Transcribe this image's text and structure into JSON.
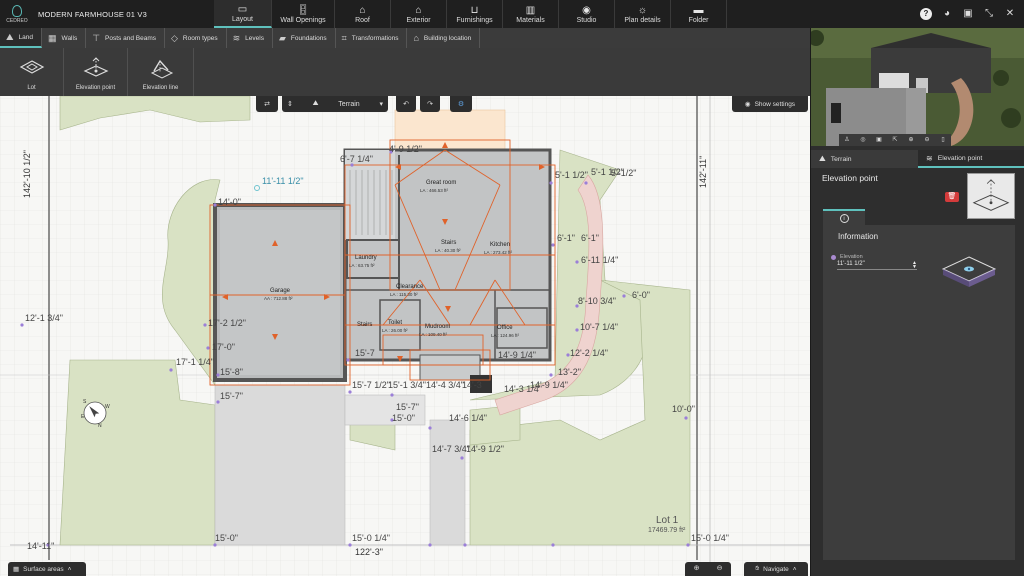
{
  "app": {
    "logo_text": "CEDREO",
    "project_title": "MODERN FARMHOUSE 01 V3"
  },
  "colors": {
    "accent": "#5fc1bd",
    "plan_lines": "#e0622a",
    "elevation_point": "#9b7fd8",
    "delete": "#d43b3b"
  },
  "main_tabs": [
    {
      "label": "Layout",
      "icon": "layout-icon"
    },
    {
      "label": "Wall Openings",
      "icon": "door-icon"
    },
    {
      "label": "Roof",
      "icon": "roof-icon"
    },
    {
      "label": "Exterior",
      "icon": "house-icon"
    },
    {
      "label": "Furnishings",
      "icon": "sofa-icon"
    },
    {
      "label": "Materials",
      "icon": "paint-roller-icon"
    },
    {
      "label": "Studio",
      "icon": "camera-icon"
    },
    {
      "label": "Plan details",
      "icon": "sun-icon"
    },
    {
      "label": "Folder",
      "icon": "folder-icon"
    }
  ],
  "sub_tabs": [
    {
      "label": "Land",
      "icon": "mountain-icon"
    },
    {
      "label": "Walls",
      "icon": "wall-icon"
    },
    {
      "label": "Posts and Beams",
      "icon": "beam-icon"
    },
    {
      "label": "Room types",
      "icon": "tag-icon"
    },
    {
      "label": "Levels",
      "icon": "levels-icon"
    },
    {
      "label": "Foundations",
      "icon": "foundation-icon"
    },
    {
      "label": "Transformations",
      "icon": "crop-icon"
    },
    {
      "label": "Building location",
      "icon": "location-icon"
    }
  ],
  "tools": [
    {
      "label": "Lot",
      "icon": "lot-icon"
    },
    {
      "label": "Elevation point",
      "icon": "elevation-point-icon"
    },
    {
      "label": "Elevation line",
      "icon": "elevation-line-icon"
    }
  ],
  "view_controls": {
    "terrain_label": "Terrain",
    "show_settings_label": "Show settings"
  },
  "bottom": {
    "surface_areas_label": "Surface areas",
    "navigate_label": "Navigate"
  },
  "plan": {
    "dimensions": {
      "left": "142'-10 1/2\"",
      "right": "142'-11\"",
      "bottom": "122'-3\""
    },
    "lot": {
      "name": "Lot 1",
      "area": "17469.79 ft²"
    },
    "rooms": [
      {
        "name": "Great room",
        "area": "LA : 466.53 ft²"
      },
      {
        "name": "Kitchen",
        "area": "LA : 273.42 ft²"
      },
      {
        "name": "Stairs",
        "area": "LA : 40.30 ft²"
      },
      {
        "name": "Laundry",
        "area": "LA : 63.75 ft²"
      },
      {
        "name": "Garage",
        "area": "AA : 712.88 ft²"
      },
      {
        "name": "Clearance",
        "area": "LA : 115.30 ft²"
      },
      {
        "name": "Stairs",
        "area": ""
      },
      {
        "name": "Toilet",
        "area": "LA : 26.00 ft²"
      },
      {
        "name": "Mudroom",
        "area": "LA : 109.40 ft²"
      },
      {
        "name": "Office",
        "area": "LA : 124.96 ft²"
      }
    ],
    "elevation_labels": [
      "11'-11 1/2\"",
      "14'-0\"",
      "6'-7 1/4\"",
      "4'-9 1/2\"",
      "5'-1 1/2\"",
      "5'-1 1/2\"",
      "5'-1/2\"",
      "6'-1\"",
      "6'-1\"",
      "6'-11 1/4\"",
      "6'-0\"",
      "8'-10 3/4\"",
      "10'-7 1/4\"",
      "12'-2 1/4\"",
      "13'-2\"",
      "14'-3 1/4\"",
      "14'-9 1/4\"",
      "12'-1 3/4\"",
      "17'-2 1/2\"",
      "17'-0\"",
      "17'-1 1/4\"",
      "15'-8\"",
      "15'-7\"",
      "15'-7 1/2\"",
      "15'-1 3/4\"",
      "14'-4 3/4\"",
      "14'-3",
      "15'-7\"",
      "15'-0\"",
      "14'-6 1/4\"",
      "14'-7 3/4\"",
      "14'-9 1/2\"",
      "10'-0\"",
      "15'-0\"",
      "15'-0 1/4\"",
      "14'-11\"",
      "15'-0 1/4\"",
      "15'-7",
      "14'-9 1/4\""
    ]
  },
  "right_panel": {
    "panel_tabs": [
      {
        "label": "Terrain",
        "icon": "terrain-icon"
      },
      {
        "label": "Elevation point",
        "icon": "layers-icon"
      }
    ],
    "title": "Elevation point",
    "info_title": "Information",
    "elevation_field": {
      "label": "Elevation",
      "value": "11'-11 1/2\""
    }
  }
}
